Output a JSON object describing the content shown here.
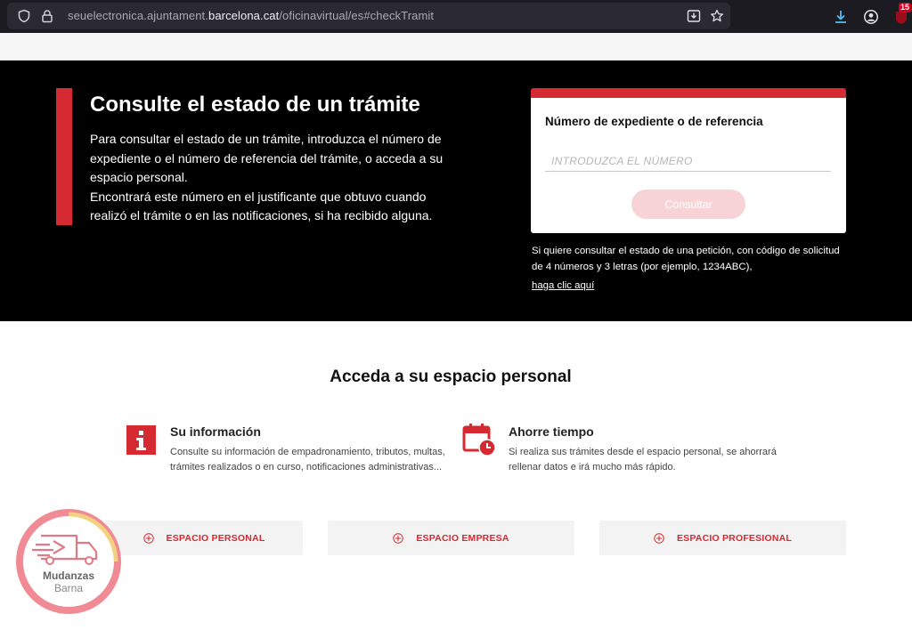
{
  "browser": {
    "url_prefix": "seuelectronica.ajuntament.",
    "url_domain": "barcelona.cat",
    "url_path": "/oficinavirtual/es#checkTramit",
    "extension_badge": "15"
  },
  "hero": {
    "title": "Consulte el estado de un trámite",
    "paragraph1": "Para consultar el estado de un trámite, introduzca el número de expediente o el número de referencia del trámite, o acceda a su espacio personal.",
    "paragraph2": "Encontrará este número en el justificante que obtuvo cuando realizó el trámite o en las notificaciones, si ha recibido alguna."
  },
  "lookup_card": {
    "label": "Número de expediente o de referencia",
    "input_placeholder": "INTRODUZCA EL NÚMERO",
    "input_value": "",
    "button_label": "Consultar"
  },
  "note": {
    "text": "Si quiere consultar el estado de una petición, con código de solicitud de 4 números y 3 letras (por ejemplo, 1234ABC),",
    "link": "haga clic aquí"
  },
  "personal": {
    "title": "Acceda a su espacio personal",
    "features": [
      {
        "icon": "info-icon",
        "title": "Su información",
        "desc": "Consulte su información de empadronamiento, tributos, multas, trámites realizados o en curso, notificaciones administrativas..."
      },
      {
        "icon": "calendar-clock-icon",
        "title": "Ahorre tiempo",
        "desc": "Si realiza sus trámites desde el espacio personal, se ahorrará rellenar datos e irá mucho más rápido."
      }
    ],
    "buttons": [
      {
        "label": "ESPACIO PERSONAL",
        "icon": "plus-circle-icon"
      },
      {
        "label": "ESPACIO EMPRESA",
        "icon": "plus-circle-icon"
      },
      {
        "label": "ESPACIO PROFESIONAL",
        "icon": "plus-circle-icon"
      }
    ]
  },
  "watermark": {
    "line1": "Mudanzas",
    "line2": "Barna"
  },
  "colors": {
    "brand_red": "#d62a32",
    "button_disabled": "#f7d3d6",
    "hero_bg": "#000000"
  }
}
